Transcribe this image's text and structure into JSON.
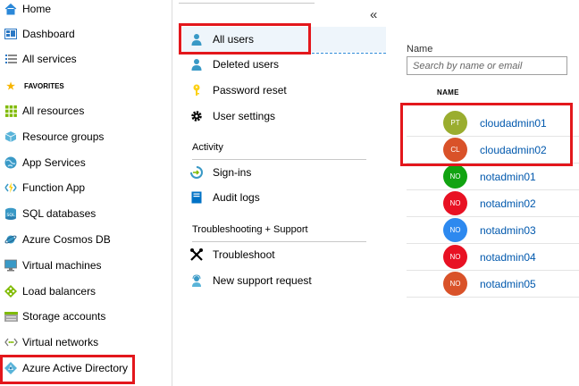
{
  "left_nav": {
    "items": [
      {
        "label": "Home",
        "icon": "home-icon"
      },
      {
        "label": "Dashboard",
        "icon": "dashboard-icon"
      },
      {
        "label": "All services",
        "icon": "list-icon"
      },
      {
        "label": "All resources",
        "icon": "grid-icon"
      },
      {
        "label": "Resource groups",
        "icon": "cube-icon"
      },
      {
        "label": "App Services",
        "icon": "globe-icon"
      },
      {
        "label": "Function App",
        "icon": "lightning-icon"
      },
      {
        "label": "SQL databases",
        "icon": "sql-icon"
      },
      {
        "label": "Azure Cosmos DB",
        "icon": "planet-icon"
      },
      {
        "label": "Virtual machines",
        "icon": "monitor-icon"
      },
      {
        "label": "Load balancers",
        "icon": "diamond-icon"
      },
      {
        "label": "Storage accounts",
        "icon": "storage-icon"
      },
      {
        "label": "Virtual networks",
        "icon": "network-icon"
      },
      {
        "label": "Azure Active Directory",
        "icon": "active-directory-icon"
      }
    ],
    "favorites_label": "FAVORITES"
  },
  "menu": {
    "collapse_glyph": "«",
    "items": [
      {
        "label": "All users",
        "icon": "user-icon"
      },
      {
        "label": "Deleted users",
        "icon": "user-icon"
      },
      {
        "label": "Password reset",
        "icon": "key-icon"
      },
      {
        "label": "User settings",
        "icon": "gear-icon"
      }
    ],
    "activity_heading": "Activity",
    "activity_items": [
      {
        "label": "Sign-ins",
        "icon": "signin-icon"
      },
      {
        "label": "Audit logs",
        "icon": "book-icon"
      }
    ],
    "support_heading": "Troubleshooting + Support",
    "support_items": [
      {
        "label": "Troubleshoot",
        "icon": "wrench-icon"
      },
      {
        "label": "New support request",
        "icon": "support-icon"
      }
    ]
  },
  "content": {
    "name_label": "Name",
    "search_placeholder": "Search by name or email",
    "column_name": "NAME",
    "users": [
      {
        "initials": "PT",
        "name": "cloudadmin01",
        "color": "#9aad2f"
      },
      {
        "initials": "CL",
        "name": "cloudadmin02",
        "color": "#d95229"
      },
      {
        "initials": "NO",
        "name": "notadmin01",
        "color": "#11a311"
      },
      {
        "initials": "NO",
        "name": "notadmin02",
        "color": "#e81123"
      },
      {
        "initials": "NO",
        "name": "notadmin03",
        "color": "#2d89ef"
      },
      {
        "initials": "NO",
        "name": "notadmin04",
        "color": "#e81123"
      },
      {
        "initials": "NO",
        "name": "notadmin05",
        "color": "#d95229"
      }
    ]
  }
}
